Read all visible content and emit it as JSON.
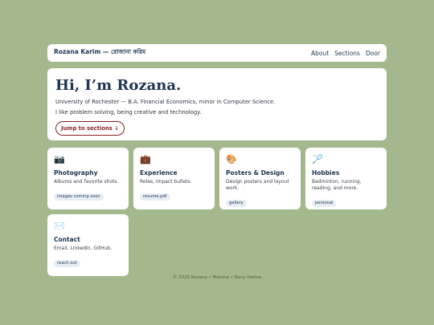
{
  "header": {
    "brand": "Rozana Karim — রোজানা করিম",
    "nav": [
      "About",
      "Sections",
      "Door"
    ]
  },
  "hero": {
    "title": "Hi, I’m Rozana.",
    "line1": "University of Rochester — B.A. Financial Economics, minor in Computer Science.",
    "line2": "I like problem solving, being creative and technology.",
    "cta": "Jump to sections ↓"
  },
  "cards": [
    {
      "icon": "📷",
      "icon_name": "camera-icon",
      "title": "Photography",
      "desc": "Albums and favorite shots.",
      "tag": "images coming soon"
    },
    {
      "icon": "💼",
      "icon_name": "briefcase-icon",
      "title": "Experience",
      "desc": "Roles, impact bullets.",
      "tag": "resume.pdf"
    },
    {
      "icon": "🎨",
      "icon_name": "palette-icon",
      "title": "Posters & Design",
      "desc": "Design posters and layout work.",
      "tag": "gallery"
    },
    {
      "icon": "🏸",
      "icon_name": "badminton-icon",
      "title": "Hobbies",
      "desc": "Badminton, running, reading, and more.",
      "tag": "personal"
    },
    {
      "icon": "✉️",
      "icon_name": "envelope-icon",
      "title": "Contact",
      "desc": "Email, LinkedIn, GitHub.",
      "tag": "reach out"
    }
  ],
  "footer": "© 2025 Rozana • Matcha • Navy theme",
  "colors": {
    "background": "#a3b88c",
    "navy": "#1f3552",
    "accent_red": "#8b1e1e"
  }
}
